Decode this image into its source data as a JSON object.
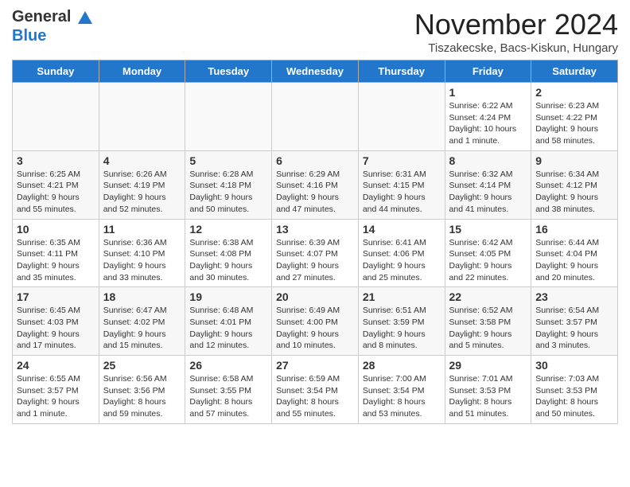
{
  "header": {
    "logo_general": "General",
    "logo_blue": "Blue",
    "title": "November 2024",
    "subtitle": "Tiszakecske, Bacs-Kiskun, Hungary"
  },
  "days_of_week": [
    "Sunday",
    "Monday",
    "Tuesday",
    "Wednesday",
    "Thursday",
    "Friday",
    "Saturday"
  ],
  "weeks": [
    [
      {
        "day": "",
        "info": "",
        "empty": true
      },
      {
        "day": "",
        "info": "",
        "empty": true
      },
      {
        "day": "",
        "info": "",
        "empty": true
      },
      {
        "day": "",
        "info": "",
        "empty": true
      },
      {
        "day": "",
        "info": "",
        "empty": true
      },
      {
        "day": "1",
        "info": "Sunrise: 6:22 AM\nSunset: 4:24 PM\nDaylight: 10 hours and 1 minute.",
        "empty": false
      },
      {
        "day": "2",
        "info": "Sunrise: 6:23 AM\nSunset: 4:22 PM\nDaylight: 9 hours and 58 minutes.",
        "empty": false
      }
    ],
    [
      {
        "day": "3",
        "info": "Sunrise: 6:25 AM\nSunset: 4:21 PM\nDaylight: 9 hours and 55 minutes.",
        "empty": false
      },
      {
        "day": "4",
        "info": "Sunrise: 6:26 AM\nSunset: 4:19 PM\nDaylight: 9 hours and 52 minutes.",
        "empty": false
      },
      {
        "day": "5",
        "info": "Sunrise: 6:28 AM\nSunset: 4:18 PM\nDaylight: 9 hours and 50 minutes.",
        "empty": false
      },
      {
        "day": "6",
        "info": "Sunrise: 6:29 AM\nSunset: 4:16 PM\nDaylight: 9 hours and 47 minutes.",
        "empty": false
      },
      {
        "day": "7",
        "info": "Sunrise: 6:31 AM\nSunset: 4:15 PM\nDaylight: 9 hours and 44 minutes.",
        "empty": false
      },
      {
        "day": "8",
        "info": "Sunrise: 6:32 AM\nSunset: 4:14 PM\nDaylight: 9 hours and 41 minutes.",
        "empty": false
      },
      {
        "day": "9",
        "info": "Sunrise: 6:34 AM\nSunset: 4:12 PM\nDaylight: 9 hours and 38 minutes.",
        "empty": false
      }
    ],
    [
      {
        "day": "10",
        "info": "Sunrise: 6:35 AM\nSunset: 4:11 PM\nDaylight: 9 hours and 35 minutes.",
        "empty": false
      },
      {
        "day": "11",
        "info": "Sunrise: 6:36 AM\nSunset: 4:10 PM\nDaylight: 9 hours and 33 minutes.",
        "empty": false
      },
      {
        "day": "12",
        "info": "Sunrise: 6:38 AM\nSunset: 4:08 PM\nDaylight: 9 hours and 30 minutes.",
        "empty": false
      },
      {
        "day": "13",
        "info": "Sunrise: 6:39 AM\nSunset: 4:07 PM\nDaylight: 9 hours and 27 minutes.",
        "empty": false
      },
      {
        "day": "14",
        "info": "Sunrise: 6:41 AM\nSunset: 4:06 PM\nDaylight: 9 hours and 25 minutes.",
        "empty": false
      },
      {
        "day": "15",
        "info": "Sunrise: 6:42 AM\nSunset: 4:05 PM\nDaylight: 9 hours and 22 minutes.",
        "empty": false
      },
      {
        "day": "16",
        "info": "Sunrise: 6:44 AM\nSunset: 4:04 PM\nDaylight: 9 hours and 20 minutes.",
        "empty": false
      }
    ],
    [
      {
        "day": "17",
        "info": "Sunrise: 6:45 AM\nSunset: 4:03 PM\nDaylight: 9 hours and 17 minutes.",
        "empty": false
      },
      {
        "day": "18",
        "info": "Sunrise: 6:47 AM\nSunset: 4:02 PM\nDaylight: 9 hours and 15 minutes.",
        "empty": false
      },
      {
        "day": "19",
        "info": "Sunrise: 6:48 AM\nSunset: 4:01 PM\nDaylight: 9 hours and 12 minutes.",
        "empty": false
      },
      {
        "day": "20",
        "info": "Sunrise: 6:49 AM\nSunset: 4:00 PM\nDaylight: 9 hours and 10 minutes.",
        "empty": false
      },
      {
        "day": "21",
        "info": "Sunrise: 6:51 AM\nSunset: 3:59 PM\nDaylight: 9 hours and 8 minutes.",
        "empty": false
      },
      {
        "day": "22",
        "info": "Sunrise: 6:52 AM\nSunset: 3:58 PM\nDaylight: 9 hours and 5 minutes.",
        "empty": false
      },
      {
        "day": "23",
        "info": "Sunrise: 6:54 AM\nSunset: 3:57 PM\nDaylight: 9 hours and 3 minutes.",
        "empty": false
      }
    ],
    [
      {
        "day": "24",
        "info": "Sunrise: 6:55 AM\nSunset: 3:57 PM\nDaylight: 9 hours and 1 minute.",
        "empty": false
      },
      {
        "day": "25",
        "info": "Sunrise: 6:56 AM\nSunset: 3:56 PM\nDaylight: 8 hours and 59 minutes.",
        "empty": false
      },
      {
        "day": "26",
        "info": "Sunrise: 6:58 AM\nSunset: 3:55 PM\nDaylight: 8 hours and 57 minutes.",
        "empty": false
      },
      {
        "day": "27",
        "info": "Sunrise: 6:59 AM\nSunset: 3:54 PM\nDaylight: 8 hours and 55 minutes.",
        "empty": false
      },
      {
        "day": "28",
        "info": "Sunrise: 7:00 AM\nSunset: 3:54 PM\nDaylight: 8 hours and 53 minutes.",
        "empty": false
      },
      {
        "day": "29",
        "info": "Sunrise: 7:01 AM\nSunset: 3:53 PM\nDaylight: 8 hours and 51 minutes.",
        "empty": false
      },
      {
        "day": "30",
        "info": "Sunrise: 7:03 AM\nSunset: 3:53 PM\nDaylight: 8 hours and 50 minutes.",
        "empty": false
      }
    ]
  ]
}
